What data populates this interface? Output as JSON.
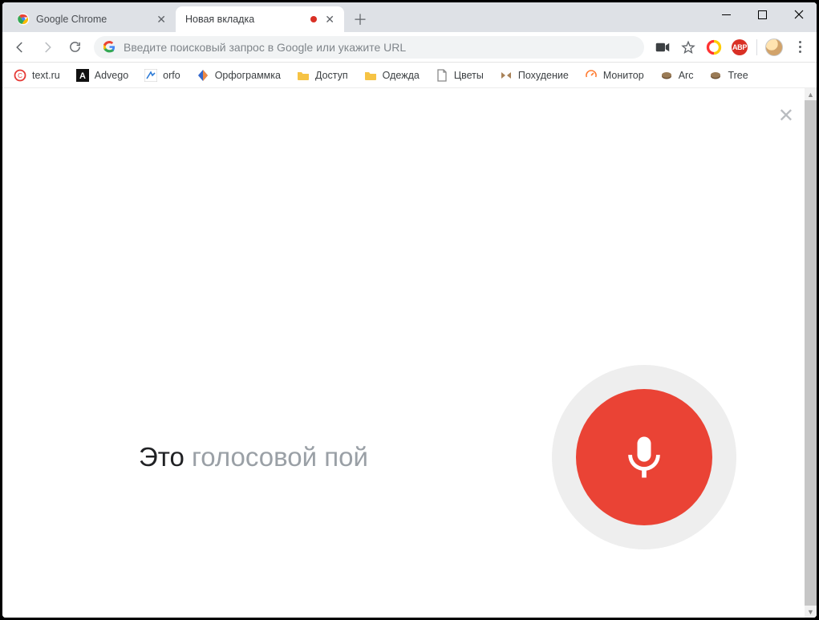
{
  "tabs": [
    {
      "title": "Google Chrome",
      "active": false
    },
    {
      "title": "Новая вкладка",
      "active": true
    }
  ],
  "omnibox": {
    "placeholder": "Введите поисковый запрос в Google или укажите URL"
  },
  "toolbar_ext": {
    "abp_label": "ABP"
  },
  "bookmarks": [
    {
      "label": "text.ru"
    },
    {
      "label": "Advego"
    },
    {
      "label": "orfo"
    },
    {
      "label": "Орфограммка"
    },
    {
      "label": "Доступ"
    },
    {
      "label": "Одежда"
    },
    {
      "label": "Цветы"
    },
    {
      "label": "Похудение"
    },
    {
      "label": "Монитор"
    },
    {
      "label": "Arc"
    },
    {
      "label": "Tree"
    }
  ],
  "voice": {
    "prefix_emph": "Это",
    "rest": " голосовой пой"
  }
}
